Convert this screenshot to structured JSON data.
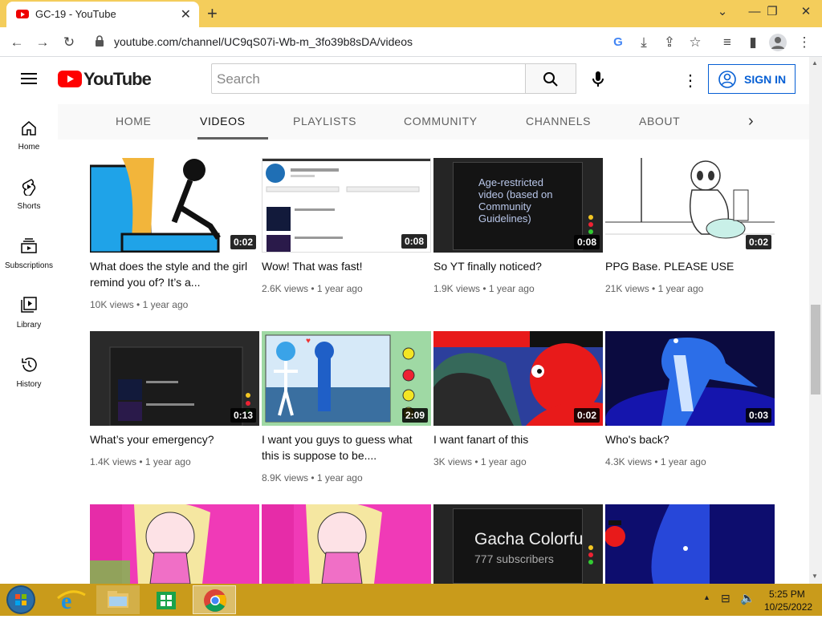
{
  "browser": {
    "tab_title": "GC-19 - YouTube",
    "url": "youtube.com/channel/UC9qS07i-Wb-m_3fo39b8sDA/videos",
    "new_tab": "+",
    "close_tab": "✕"
  },
  "yt": {
    "logo_text": "YouTube",
    "search_placeholder": "Search",
    "sign_in": "SIGN IN"
  },
  "sidebar": [
    {
      "label": "Home",
      "icon": "home-icon"
    },
    {
      "label": "Shorts",
      "icon": "shorts-icon"
    },
    {
      "label": "Subscriptions",
      "icon": "subscriptions-icon"
    },
    {
      "label": "Library",
      "icon": "library-icon"
    },
    {
      "label": "History",
      "icon": "history-icon"
    }
  ],
  "channel_tabs": [
    "HOME",
    "VIDEOS",
    "PLAYLISTS",
    "COMMUNITY",
    "CHANNELS",
    "ABOUT"
  ],
  "videos": [
    {
      "title": "What does the style and the girl remind you of? It’s a...",
      "views": "10K views",
      "age": "1 year ago",
      "duration": "0:02"
    },
    {
      "title": "Wow! That was fast!",
      "views": "2.6K views",
      "age": "1 year ago",
      "duration": "0:08"
    },
    {
      "title": "So YT finally noticed?",
      "views": "1.9K views",
      "age": "1 year ago",
      "duration": "0:08",
      "thumb_text": "Age-restricted video (based on Community Guidelines)"
    },
    {
      "title": "PPG Base. PLEASE USE",
      "views": "21K views",
      "age": "1 year ago",
      "duration": "0:02"
    },
    {
      "title": "What’s your emergency?",
      "views": "1.4K views",
      "age": "1 year ago",
      "duration": "0:13"
    },
    {
      "title": "I want you guys to guess what this is suppose to be....",
      "views": "8.9K views",
      "age": "1 year ago",
      "duration": "2:09"
    },
    {
      "title": "I want fanart of this",
      "views": "3K views",
      "age": "1 year ago",
      "duration": "0:02"
    },
    {
      "title": "Who's back?",
      "views": "4.3K views",
      "age": "1 year ago",
      "duration": "0:03"
    }
  ],
  "row3": {
    "thumb3_title": "Gacha Colorfu",
    "thumb3_subs": "777 subscribers"
  },
  "taskbar": {
    "time": "5:25 PM",
    "date": "10/25/2022"
  },
  "colors": {
    "tabstrip": "#f4cd5b",
    "taskbar": "#c99b1b",
    "yt_red": "#ff0000",
    "link_blue": "#065fd4"
  }
}
